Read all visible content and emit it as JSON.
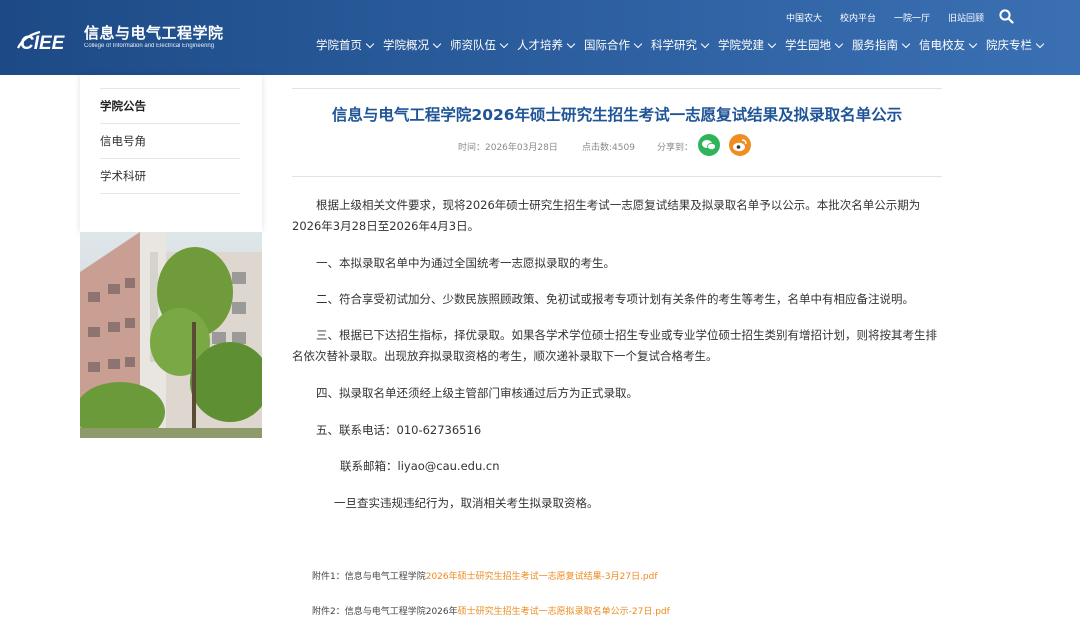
{
  "header": {
    "logo_cn": "信息与电气工程学院",
    "logo_en": "College of Information and Electrical Engineering",
    "logo_mark": "CIEE",
    "top_links": [
      "中国农大",
      "校内平台",
      "一院一厅",
      "旧站回顾"
    ],
    "nav": [
      "学院首页",
      "学院概况",
      "师资队伍",
      "人才培养",
      "国际合作",
      "科学研究",
      "学院党建",
      "学生园地",
      "服务指南",
      "信电校友",
      "院庆专栏"
    ]
  },
  "sidebar": {
    "items": [
      "学院公告",
      "信电号角",
      "学术科研"
    ]
  },
  "article": {
    "title": "信息与电气工程学院2026年硕士研究生招生考试一志愿复试结果及拟录取名单公示",
    "meta_time": "时间：2026年03月28日",
    "meta_clicks": "点击数:4509",
    "meta_share": "分享到：",
    "p1": "根据上级相关文件要求，现将2026年硕士研究生招生考试一志愿复试结果及拟录取名单予以公示。本批次名单公示期为2026年3月28日至2026年4月3日。",
    "p2": "一、本拟录取名单中为通过全国统考一志愿拟录取的考生。",
    "p3": "二、符合享受初试加分、少数民族照顾政策、免初试或报考专项计划有关条件的考生等考生，名单中有相应备注说明。",
    "p4": "三、根据已下达招生指标，择优录取。如果各学术学位硕士招生专业或专业学位硕士招生类别有增招计划，则将按其考生排名依次替补录取。出现放弃拟录取资格的考生，顺次递补录取下一个复试合格考生。",
    "p5": "四、拟录取名单还须经上级主管部门审核通过后方为正式录取。",
    "p6": "五、联系电话：010-62736516",
    "p7": "联系邮箱：liyao@cau.edu.cn",
    "p8": "一旦查实违规违纪行为，取消相关考生拟录取资格。",
    "attach1_prefix": "附件1：信息与电气工程学院",
    "attach1_link": "2026年硕士研究生招生考试一志愿复试结果-3月27日.pdf",
    "attach2_prefix": "附件2：信息与电气工程学院2026年",
    "attach2_link": "硕士研究生招生考试一志愿拟录取名单公示-27日.pdf"
  },
  "colors": {
    "header_bg": "#2a5c9c",
    "title": "#1f5596",
    "link": "#ee8a1f",
    "wechat": "#2fb45a",
    "weibo": "#f08d22"
  },
  "icons": [
    "search-icon",
    "chevron-down-icon",
    "wechat-icon",
    "weibo-icon"
  ]
}
